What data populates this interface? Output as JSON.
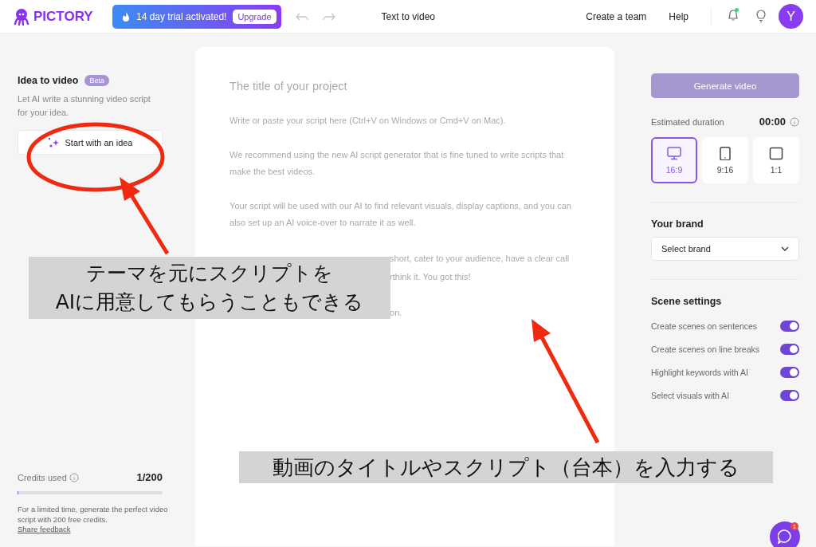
{
  "header": {
    "logo": "PICTORY",
    "trial": {
      "text": "14 day trial activated!",
      "button": "Upgrade"
    },
    "title": "Text to video",
    "links": [
      "Create a team",
      "Help"
    ],
    "notification_dot": true,
    "avatar": "Y"
  },
  "idea_panel": {
    "title": "Idea to video",
    "badge": "Beta",
    "description": "Let AI write a stunning video script for your idea.",
    "button": "Start with an idea"
  },
  "credits": {
    "label": "Credits used",
    "value": "1/200",
    "level": 0.005,
    "note": "For a limited time, generate the perfect video script with 200 free credits.",
    "link": "Share feedback"
  },
  "editor": {
    "title_placeholder": "The title of your project",
    "paragraphs": [
      "Write or paste your script here (Ctrl+V on Windows or Cmd+V on Mac).",
      "We recommend using the new AI script generator that is fine tuned to write scripts that make the best videos.",
      "Your script will be used with our AI to find relevant visuals, display captions, and you can also set up an AI voice-over to narrate it as well."
    ],
    "covered_lines": [
      "short, cater to your audience, have a clear call",
      "rthink it. You got this!",
      "on."
    ]
  },
  "settings": {
    "generate_button": "Generate video",
    "duration_label": "Estimated duration",
    "duration": "00:00",
    "aspects": [
      {
        "kind": "landscape",
        "label": "16:9",
        "selected": true
      },
      {
        "kind": "portrait",
        "label": "9:16",
        "selected": false
      },
      {
        "kind": "square",
        "label": "1:1",
        "selected": false
      }
    ],
    "brand_title": "Your brand",
    "brand_select": "Select brand",
    "scene_title": "Scene settings",
    "toggles": [
      {
        "label": "Create scenes on sentences",
        "on": true
      },
      {
        "label": "Create scenes on line breaks",
        "on": true
      },
      {
        "label": "Highlight keywords with AI",
        "on": true
      },
      {
        "label": "Select visuals with AI",
        "on": true
      }
    ]
  },
  "chat_badge": "1",
  "annotations": [
    {
      "kind": "caption",
      "text": "テーマを元にスクリプトを\nAIに用意してもらうこともできる"
    },
    {
      "kind": "caption",
      "text": "動画のタイトルやスクリプト（台本）を入力する"
    }
  ]
}
